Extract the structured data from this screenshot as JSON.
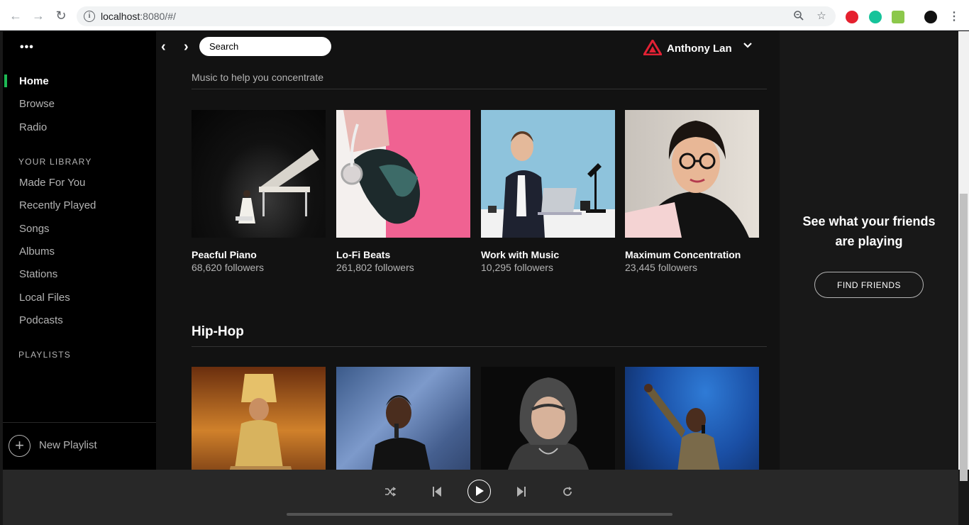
{
  "browser": {
    "url_host": "localhost",
    "url_rest": ":8080/#/"
  },
  "sidebar": {
    "menu_dots": "•••",
    "nav": [
      {
        "label": "Home",
        "active": true
      },
      {
        "label": "Browse"
      },
      {
        "label": "Radio"
      }
    ],
    "library_title": "YOUR LIBRARY",
    "library": [
      {
        "label": "Made For You"
      },
      {
        "label": "Recently Played"
      },
      {
        "label": "Songs"
      },
      {
        "label": "Albums"
      },
      {
        "label": "Stations"
      },
      {
        "label": "Local Files"
      },
      {
        "label": "Podcasts"
      }
    ],
    "playlists_title": "PLAYLISTS",
    "new_playlist_label": "New Playlist"
  },
  "header": {
    "search_placeholder": "Search",
    "user_name": "Anthony Lan"
  },
  "main": {
    "focus_subtitle": "Music to help you concentrate",
    "focus_cards": [
      {
        "title": "Peacful Piano",
        "followers": "68,620 followers",
        "image": "piano-image"
      },
      {
        "title": "Lo-Fi Beats",
        "followers": "261,802 followers",
        "image": "headphones-image"
      },
      {
        "title": "Work with Music",
        "followers": "10,295 followers",
        "image": "office-image"
      },
      {
        "title": "Maximum Concentration",
        "followers": "23,445 followers",
        "image": "reading-image"
      }
    ],
    "hiphop_heading": "Hip-Hop",
    "hiphop_cards": [
      {
        "image": "artist-gold-image"
      },
      {
        "image": "artist-mic-image"
      },
      {
        "image": "artist-hoodie-image"
      },
      {
        "image": "artist-stage-image"
      }
    ]
  },
  "friends": {
    "message_line1": "See what your friends",
    "message_line2": "are playing",
    "button_label": "FIND FRIENDS"
  },
  "player": {
    "controls": [
      "shuffle-icon",
      "previous-icon",
      "play-icon",
      "next-icon",
      "repeat-icon"
    ]
  },
  "colors": {
    "accent": "#1db954",
    "background": "#121212",
    "sidebar": "#000000",
    "player": "#282828"
  }
}
